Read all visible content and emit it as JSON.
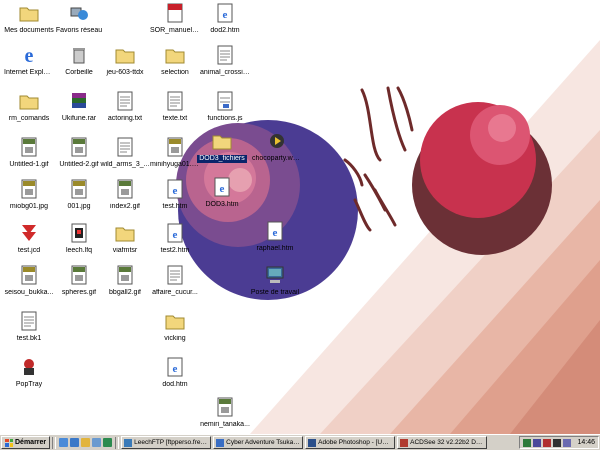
{
  "desktop": {
    "icons": [
      {
        "label": "Mes documents",
        "icon": "folder-icon"
      },
      {
        "label": "Favoris réseau",
        "icon": "network-icon"
      },
      {
        "label": "SOR_manuel_...",
        "icon": "pdf-icon"
      },
      {
        "label": "dod2.htm",
        "icon": "ie-document-icon"
      },
      {
        "label": "Internet Explorer",
        "icon": "ie-icon"
      },
      {
        "label": "Corbeille",
        "icon": "recycle-bin-icon"
      },
      {
        "label": "jeu-603-ttdx",
        "icon": "folder-icon"
      },
      {
        "label": "selection",
        "icon": "folder-icon"
      },
      {
        "label": "animal_crossin...",
        "icon": "text-file-icon"
      },
      {
        "label": "rm_comands",
        "icon": "folder-icon"
      },
      {
        "label": "Ukifune.rar",
        "icon": "rar-icon"
      },
      {
        "label": "actoring.txt",
        "icon": "text-file-icon"
      },
      {
        "label": "texte.txt",
        "icon": "text-file-icon"
      },
      {
        "label": "functions.js",
        "icon": "js-file-icon"
      },
      {
        "label": "Untitled-1.gif",
        "icon": "gif-icon"
      },
      {
        "label": "Untitled-2.gif",
        "icon": "gif-icon"
      },
      {
        "label": "wild_arms_3_...",
        "icon": "text-file-icon"
      },
      {
        "label": "minihyuga01.jpg",
        "icon": "jpg-icon"
      },
      {
        "label": "DOD3_fichiers",
        "icon": "folder-icon"
      },
      {
        "label": "chocoparty.wmv",
        "icon": "video-icon"
      },
      {
        "label": "miobg01.jpg",
        "icon": "jpg-icon"
      },
      {
        "label": "001.jpg",
        "icon": "jpg-icon"
      },
      {
        "label": "index2.gif",
        "icon": "gif-icon"
      },
      {
        "label": "test.htm",
        "icon": "ie-document-icon"
      },
      {
        "label": "DOD3.htm",
        "icon": "ie-document-icon"
      },
      {
        "label": "test.jcd",
        "icon": "jcd-icon"
      },
      {
        "label": "leech.lfq",
        "icon": "lfq-icon"
      },
      {
        "label": "viafmtsr",
        "icon": "folder-icon"
      },
      {
        "label": "test2.htm",
        "icon": "ie-document-icon"
      },
      {
        "label": "raphael.htm",
        "icon": "ie-document-icon"
      },
      {
        "label": "seisou_bukka...",
        "icon": "jpg-icon"
      },
      {
        "label": "spheres.gif",
        "icon": "gif-icon"
      },
      {
        "label": "bbgall2.gif",
        "icon": "gif-icon"
      },
      {
        "label": "affaire_cucur...",
        "icon": "text-file-icon"
      },
      {
        "label": "Poste de travail",
        "icon": "computer-icon"
      },
      {
        "label": "test.bk1",
        "icon": "text-file-icon"
      },
      {
        "label": "vicking",
        "icon": "folder-icon"
      },
      {
        "label": "PopTray",
        "icon": "poptray-icon"
      },
      {
        "label": "dod.htm",
        "icon": "ie-document-icon"
      },
      {
        "label": "nemiri_tanaka...",
        "icon": "gif-icon"
      }
    ]
  },
  "taskbar": {
    "start_label": "Démarrer",
    "tasks": [
      {
        "label": "LeechFTP [ftpperso.free....",
        "color": "#3a7ab8"
      },
      {
        "label": "Cyber Adventure Tsuka |...",
        "color": "#3a6ec4"
      },
      {
        "label": "Adobe Photoshop - [Unti...",
        "color": "#2b4f8a"
      },
      {
        "label": "ACDSee 32 v2.22b2 Dec ...",
        "color": "#b03a2e"
      }
    ],
    "clock": "14:46"
  },
  "colors": {
    "wallpaper_base": "#ffffff",
    "stripe_light": "#f3dad3",
    "stripe_mid": "#e9b8aa",
    "sphere_left": "#4b3c93",
    "sphere_left_highlight": "#d4789a",
    "sphere_right": "#6b3036",
    "sphere_right_highlight": "#c8324e",
    "taskbar": "#d4d0c8",
    "selection": "#0a246a"
  }
}
